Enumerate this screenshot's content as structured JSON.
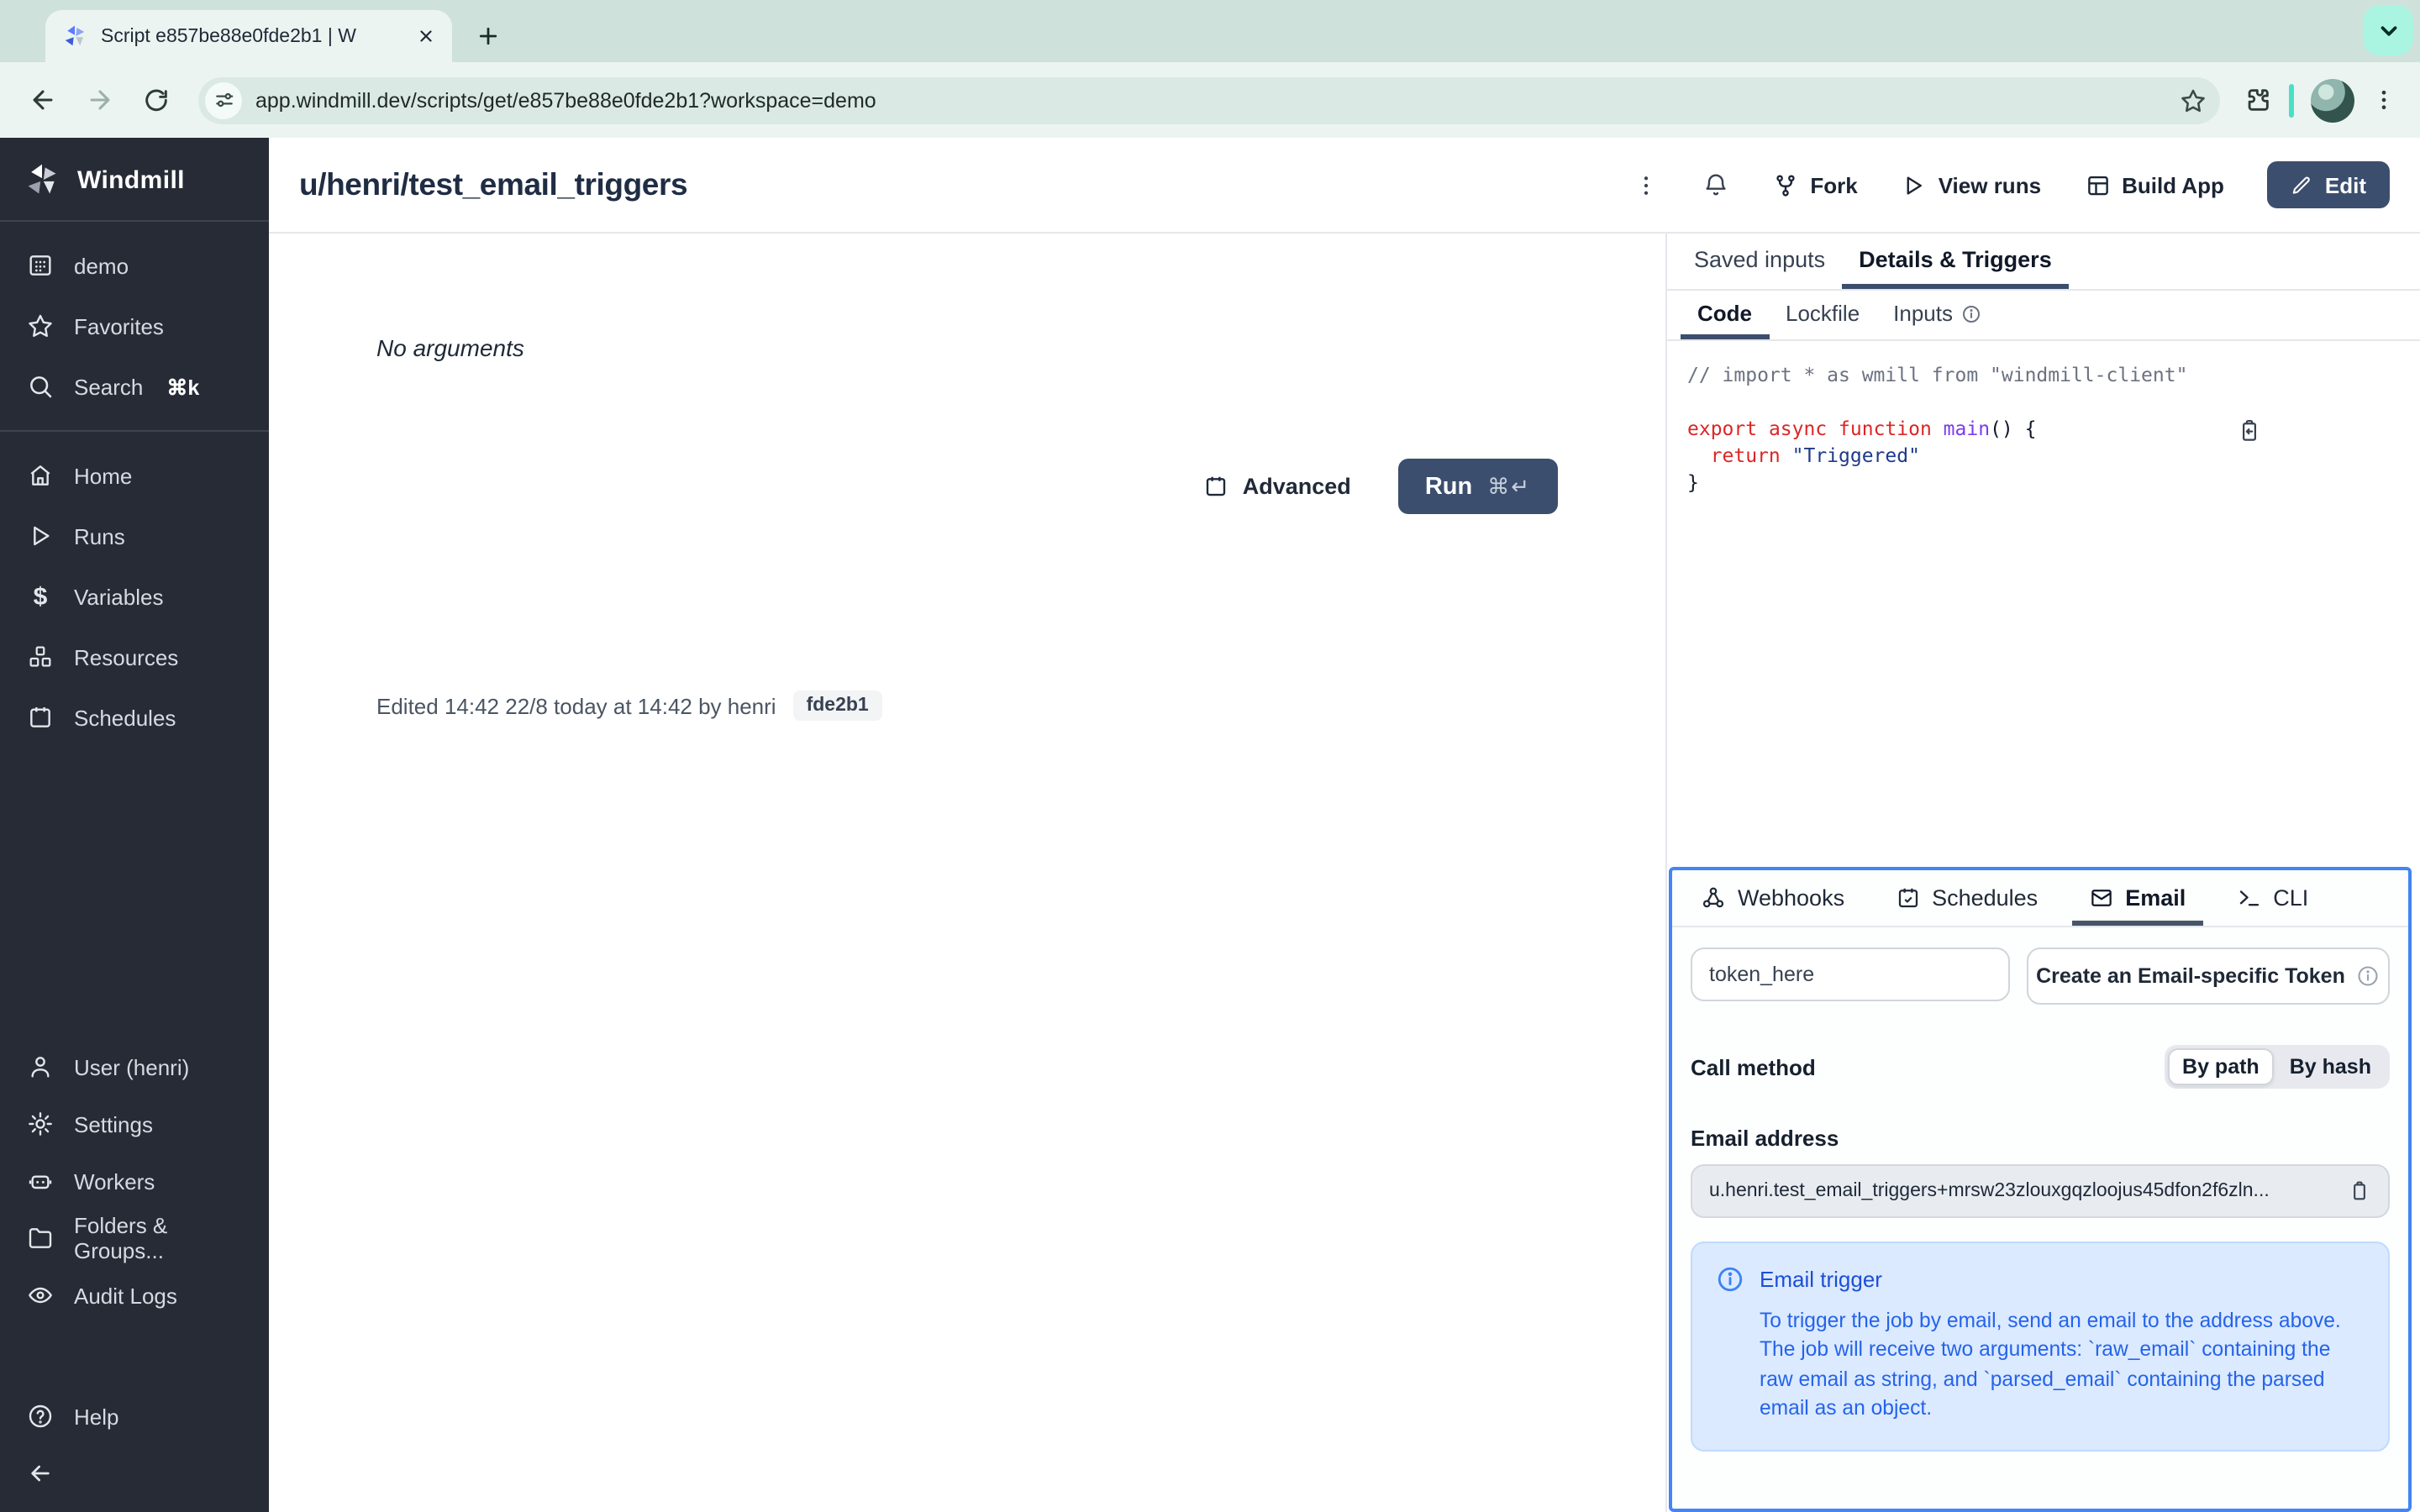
{
  "browser": {
    "tab_title": "Script e857be88e0fde2b1 | W",
    "url": "app.windmill.dev/scripts/get/e857be88e0fde2b1?workspace=demo"
  },
  "sidebar": {
    "brand": "Windmill",
    "items_top": [
      {
        "label": "demo"
      },
      {
        "label": "Favorites"
      },
      {
        "label": "Search",
        "shortcut": "⌘k"
      }
    ],
    "items_main": [
      {
        "label": "Home"
      },
      {
        "label": "Runs"
      },
      {
        "label": "Variables"
      },
      {
        "label": "Resources"
      },
      {
        "label": "Schedules"
      }
    ],
    "items_bottom": [
      {
        "label": "User (henri)"
      },
      {
        "label": "Settings"
      },
      {
        "label": "Workers"
      },
      {
        "label": "Folders & Groups..."
      },
      {
        "label": "Audit Logs"
      }
    ],
    "help_label": "Help"
  },
  "header": {
    "title": "u/henri/test_email_triggers",
    "fork_label": "Fork",
    "view_runs_label": "View runs",
    "build_app_label": "Build App",
    "edit_label": "Edit"
  },
  "run_panel": {
    "no_arguments": "No arguments",
    "advanced_label": "Advanced",
    "run_label": "Run",
    "run_shortcut": "⌘↵",
    "edited_line": "Edited 14:42 22/8 today at 14:42 by henri",
    "version_badge": "fde2b1"
  },
  "details": {
    "tab_saved_inputs": "Saved inputs",
    "tab_details_triggers": "Details & Triggers",
    "subtab_code": "Code",
    "subtab_lockfile": "Lockfile",
    "subtab_inputs": "Inputs",
    "code": {
      "comment": "// import * as wmill from \"windmill-client\"",
      "kw_export": "export",
      "kw_async": " async",
      "kw_function": " function",
      "fn_main": " main",
      "punct_open": "() {",
      "indent_return": "  return ",
      "str_triggered": "\"Triggered\"",
      "close_brace": "}"
    }
  },
  "triggers": {
    "tab_webhooks": "Webhooks",
    "tab_schedules": "Schedules",
    "tab_email": "Email",
    "tab_cli": "CLI",
    "token_value": "token_here",
    "create_token_label": "Create an Email-specific Token",
    "call_method_label": "Call method",
    "by_path_label": "By path",
    "by_hash_label": "By hash",
    "email_address_label": "Email address",
    "email_address_value": "u.henri.test_email_triggers+mrsw23zlouxgqzloojus45dfon2f6zln...",
    "info_title": "Email trigger",
    "info_body": "To trigger the job by email, send an email to the address above. The job will receive two arguments: `raw_email` containing the raw email as string, and `parsed_email` containing the parsed email as an object."
  },
  "colors": {
    "accent_blue": "#4285f4",
    "primary_button": "#3c4e6d",
    "sidebar_bg": "#262b36",
    "info_bg": "#dbeafe"
  }
}
